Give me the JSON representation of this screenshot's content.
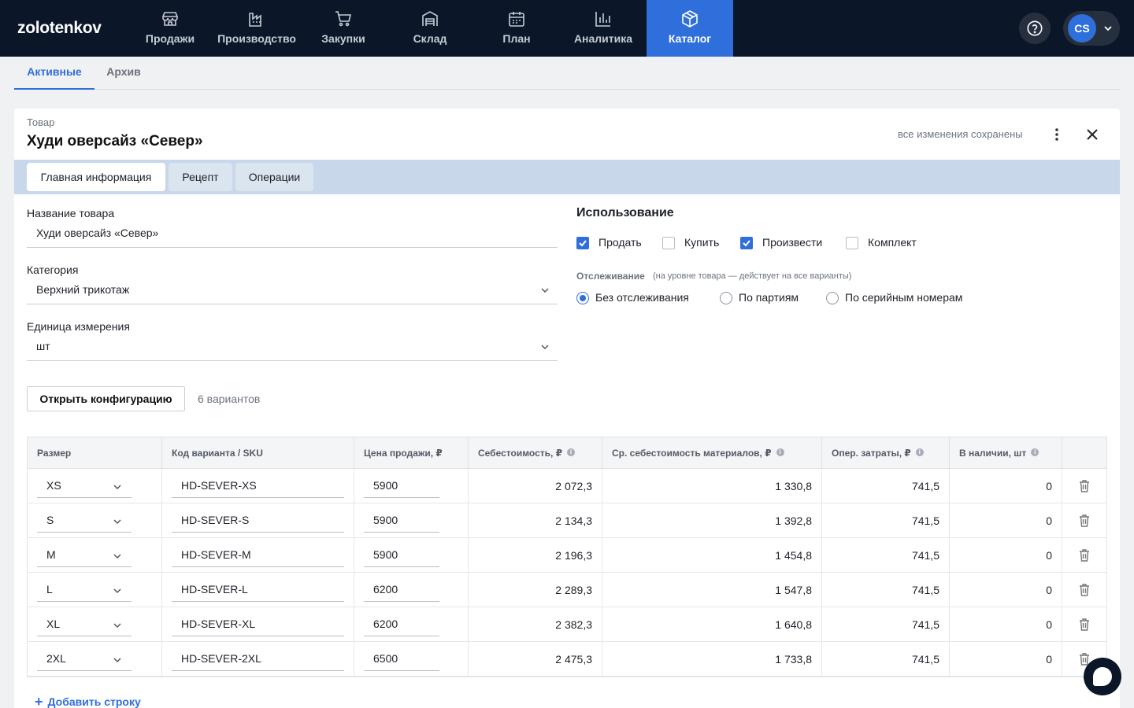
{
  "app": {
    "logo": "zolotenkov"
  },
  "nav": [
    {
      "label": "Продажи",
      "icon": "store-icon",
      "active": false
    },
    {
      "label": "Производство",
      "icon": "factory-icon",
      "active": false
    },
    {
      "label": "Закупки",
      "icon": "cart-icon",
      "active": false
    },
    {
      "label": "Склад",
      "icon": "warehouse-icon",
      "active": false
    },
    {
      "label": "План",
      "icon": "calendar-icon",
      "active": false
    },
    {
      "label": "Аналитика",
      "icon": "bar-chart-icon",
      "active": false
    },
    {
      "label": "Каталог",
      "icon": "box-icon",
      "active": true
    }
  ],
  "user": {
    "initials": "CS"
  },
  "subtabs": {
    "active": "Активные",
    "archive": "Архив"
  },
  "card": {
    "kicker": "Товар",
    "title": "Худи оверсайз «Север»",
    "saved_status": "все изменения сохранены"
  },
  "tabs": {
    "main": "Главная информация",
    "recipe": "Рецепт",
    "operations": "Операции"
  },
  "form": {
    "name_label": "Название товара",
    "name_value": "Худи оверсайз «Север»",
    "category_label": "Категория",
    "category_value": "Верхний трикотаж",
    "unit_label": "Единица измерения",
    "unit_value": "шт"
  },
  "usage": {
    "title": "Использование",
    "sell": "Продать",
    "buy": "Купить",
    "produce": "Произвести",
    "kit": "Комплект",
    "sell_checked": true,
    "buy_checked": false,
    "produce_checked": true,
    "kit_checked": false
  },
  "tracking": {
    "label": "Отслеживание",
    "hint": "(на уровне товара — действует на все варианты)",
    "none": "Без отслеживания",
    "batches": "По партиям",
    "serial": "По серийным номерам",
    "selected": "none"
  },
  "config": {
    "button": "Открыть конфигурацию",
    "count": "6 вариантов"
  },
  "table": {
    "headers": {
      "size": "Размер",
      "sku": "Код варианта / SKU",
      "price": "Цена продажи, ₽",
      "cost": "Себестоимость, ₽",
      "materials": "Ср. себестоимость материалов, ₽",
      "ops": "Опер. затраты, ₽",
      "stock": "В наличии, шт"
    },
    "rows": [
      {
        "size": "XS",
        "sku": "HD-SEVER-XS",
        "price": "5900",
        "cost": "2 072,3",
        "materials": "1 330,8",
        "ops": "741,5",
        "stock": "0"
      },
      {
        "size": "S",
        "sku": "HD-SEVER-S",
        "price": "5900",
        "cost": "2 134,3",
        "materials": "1 392,8",
        "ops": "741,5",
        "stock": "0"
      },
      {
        "size": "M",
        "sku": "HD-SEVER-M",
        "price": "5900",
        "cost": "2 196,3",
        "materials": "1 454,8",
        "ops": "741,5",
        "stock": "0"
      },
      {
        "size": "L",
        "sku": "HD-SEVER-L",
        "price": "6200",
        "cost": "2 289,3",
        "materials": "1 547,8",
        "ops": "741,5",
        "stock": "0"
      },
      {
        "size": "XL",
        "sku": "HD-SEVER-XL",
        "price": "6200",
        "cost": "2 382,3",
        "materials": "1 640,8",
        "ops": "741,5",
        "stock": "0"
      },
      {
        "size": "2XL",
        "sku": "HD-SEVER-2XL",
        "price": "6500",
        "cost": "2 475,3",
        "materials": "1 733,8",
        "ops": "741,5",
        "stock": "0"
      }
    ],
    "add_row": "Добавить строку"
  },
  "colors": {
    "nav_bg": "#0b1628",
    "accent": "#2f6fdb",
    "tabbar_bg": "#c8d8ea"
  }
}
